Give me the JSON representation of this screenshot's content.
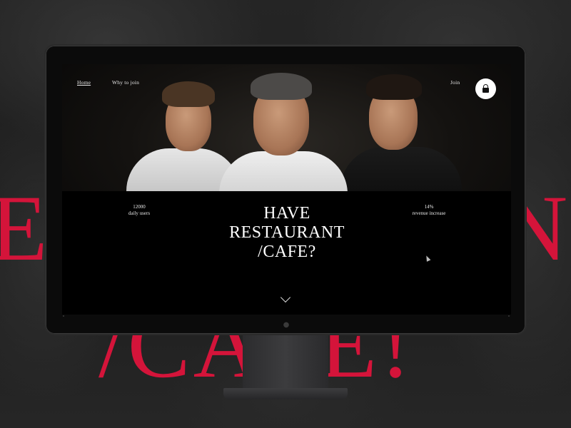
{
  "backdrop": {
    "line1_left": "E",
    "line1_right": "N",
    "line2": "/CAFE!",
    "accent_color": "#d4143a"
  },
  "nav": {
    "home": "Home",
    "why_join": "Why to join",
    "join": "Join",
    "lock_icon": "lock-icon"
  },
  "stats": {
    "left": {
      "value": "12000",
      "label": "daily users"
    },
    "right": {
      "value": "14%",
      "label": "revenue increase"
    }
  },
  "headline": {
    "line1": "HAVE",
    "line2": "RESTAURANT",
    "line3": "/CAFE?"
  },
  "scroll_icon": "chevron-down-icon"
}
